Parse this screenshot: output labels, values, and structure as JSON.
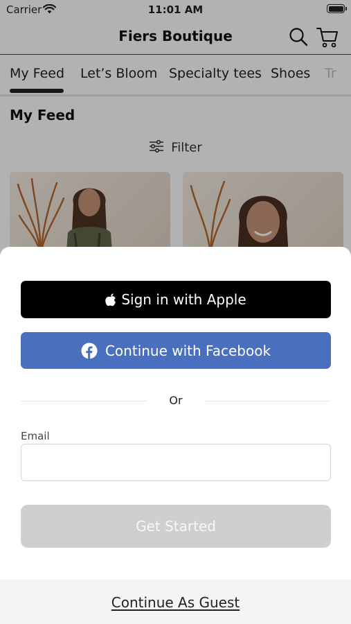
{
  "status_bar": {
    "carrier": "Carrier",
    "time": "11:01 AM"
  },
  "nav": {
    "title": "Fiers Boutique",
    "icons": [
      "search-icon",
      "cart-icon"
    ]
  },
  "tabs": [
    {
      "label": "My Feed",
      "selected": true
    },
    {
      "label": "Let’s Bloom",
      "selected": false
    },
    {
      "label": "Specialty tees",
      "selected": false
    },
    {
      "label": "Shoes",
      "selected": false
    },
    {
      "label": "Tr",
      "selected": false
    }
  ],
  "feed": {
    "title": "My Feed",
    "filter_label": "Filter"
  },
  "sheet": {
    "apple_button_label": "Sign in with Apple",
    "facebook_button_label": "Continue with Facebook",
    "divider_text": "Or",
    "email_label": "Email",
    "email_value": "",
    "email_placeholder": "",
    "get_started_label": "Get Started",
    "guest_link_label": "Continue As Guest"
  },
  "colors": {
    "apple_button": "#000000",
    "facebook_button": "#4a6fbe",
    "get_started_disabled": "#cfcfcf",
    "overlay": "rgba(0,0,0,0.3)"
  }
}
